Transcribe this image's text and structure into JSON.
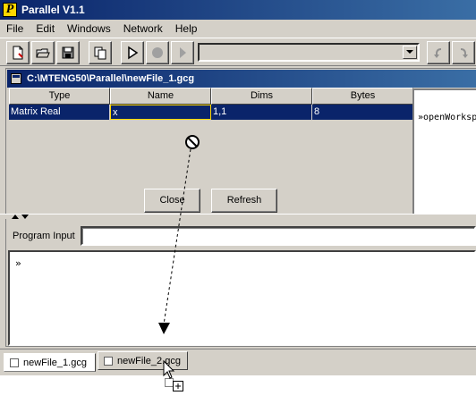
{
  "window": {
    "title": "Parallel V1.1",
    "icon_letter": "P"
  },
  "menubar": {
    "items": [
      "File",
      "Edit",
      "Windows",
      "Network",
      "Help"
    ]
  },
  "toolbar": {
    "buttons": [
      "new-file",
      "open-folder",
      "save",
      "copy",
      "run",
      "stop",
      "step",
      "undo",
      "redo"
    ],
    "combo_value": ""
  },
  "document": {
    "title": "C:\\MTENG50\\Parallel\\newFile_1.gcg"
  },
  "variables": {
    "columns": [
      "Type",
      "Name",
      "Dims",
      "Bytes"
    ],
    "rows": [
      {
        "type": "Matrix Real",
        "name": "x",
        "dims": "1,1",
        "bytes": "8"
      }
    ]
  },
  "buttons": {
    "close": "Close",
    "refresh": "Refresh"
  },
  "output": {
    "text": "»openWorkspace"
  },
  "program_input": {
    "label": "Program Input",
    "value": ""
  },
  "console": {
    "prompt": "»"
  },
  "file_tabs": [
    {
      "label": "newFile_1.gcg",
      "active": true
    },
    {
      "label": "newFile_2.gcg",
      "active": false
    }
  ],
  "colors": {
    "titlebar_start": "#0a246a",
    "titlebar_end": "#3a6ea5",
    "selection": "#0a246a",
    "face": "#d4d0c8",
    "name_cell_border": "#ffd700"
  }
}
